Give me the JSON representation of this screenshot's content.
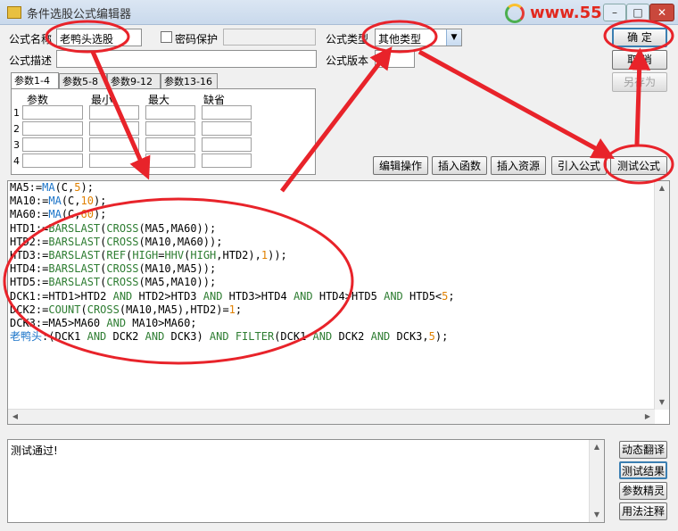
{
  "window": {
    "title": "条件选股公式编辑器",
    "watermark": "www.5518",
    "controls": [
      "–",
      "□",
      "✕"
    ]
  },
  "form": {
    "name_label": "公式名称",
    "name_value": "老鸭头选股",
    "password_label": "密码保护",
    "type_label": "公式类型",
    "type_value": "其他类型",
    "desc_label": "公式描述",
    "desc_value": "",
    "version_label": "公式版本",
    "version_value": "0"
  },
  "buttons": {
    "ok": "确  定",
    "cancel": "取  消",
    "save_as": "另存为",
    "edit_op": "编辑操作",
    "insert_func": "插入函数",
    "insert_res": "插入资源",
    "import": "引入公式",
    "test": "测试公式"
  },
  "params": {
    "tabs": [
      "参数1-4",
      "参数5-8",
      "参数9-12",
      "参数13-16"
    ],
    "headers": [
      "参数",
      "最小",
      "最大",
      "缺省"
    ],
    "rows": [
      "1",
      "2",
      "3",
      "4"
    ]
  },
  "code_lines": [
    [
      {
        "t": "MA5:=",
        "c": "#000000"
      },
      {
        "t": "MA",
        "c": "#1a73c8"
      },
      {
        "t": "(C,",
        "c": "#000000"
      },
      {
        "t": "5",
        "c": "#e08000"
      },
      {
        "t": ");",
        "c": "#000000"
      }
    ],
    [
      {
        "t": "MA10:=",
        "c": "#000000"
      },
      {
        "t": "MA",
        "c": "#1a73c8"
      },
      {
        "t": "(C,",
        "c": "#000000"
      },
      {
        "t": "10",
        "c": "#e08000"
      },
      {
        "t": ");",
        "c": "#000000"
      }
    ],
    [
      {
        "t": "MA60:=",
        "c": "#000000"
      },
      {
        "t": "MA",
        "c": "#1a73c8"
      },
      {
        "t": "(C,",
        "c": "#000000"
      },
      {
        "t": "60",
        "c": "#e08000"
      },
      {
        "t": ");",
        "c": "#000000"
      }
    ],
    [
      {
        "t": "HTD1:=",
        "c": "#000000"
      },
      {
        "t": "BARSLAST",
        "c": "#2e7d32"
      },
      {
        "t": "(",
        "c": "#000000"
      },
      {
        "t": "CROSS",
        "c": "#2e7d32"
      },
      {
        "t": "(MA5,MA60));",
        "c": "#000000"
      }
    ],
    [
      {
        "t": "HTD2:=",
        "c": "#000000"
      },
      {
        "t": "BARSLAST",
        "c": "#2e7d32"
      },
      {
        "t": "(",
        "c": "#000000"
      },
      {
        "t": "CROSS",
        "c": "#2e7d32"
      },
      {
        "t": "(MA10,MA60));",
        "c": "#000000"
      }
    ],
    [
      {
        "t": "HTD3:=",
        "c": "#000000"
      },
      {
        "t": "BARSLAST",
        "c": "#2e7d32"
      },
      {
        "t": "(",
        "c": "#000000"
      },
      {
        "t": "REF",
        "c": "#2e7d32"
      },
      {
        "t": "(",
        "c": "#000000"
      },
      {
        "t": "HIGH",
        "c": "#2e7d32"
      },
      {
        "t": "=",
        "c": "#000000"
      },
      {
        "t": "HHV",
        "c": "#2e7d32"
      },
      {
        "t": "(",
        "c": "#000000"
      },
      {
        "t": "HIGH",
        "c": "#2e7d32"
      },
      {
        "t": ",HTD2),",
        "c": "#000000"
      },
      {
        "t": "1",
        "c": "#e08000"
      },
      {
        "t": "));",
        "c": "#000000"
      }
    ],
    [
      {
        "t": "HTD4:=",
        "c": "#000000"
      },
      {
        "t": "BARSLAST",
        "c": "#2e7d32"
      },
      {
        "t": "(",
        "c": "#000000"
      },
      {
        "t": "CROSS",
        "c": "#2e7d32"
      },
      {
        "t": "(MA10,MA5));",
        "c": "#000000"
      }
    ],
    [
      {
        "t": "HTD5:=",
        "c": "#000000"
      },
      {
        "t": "BARSLAST",
        "c": "#2e7d32"
      },
      {
        "t": "(",
        "c": "#000000"
      },
      {
        "t": "CROSS",
        "c": "#2e7d32"
      },
      {
        "t": "(MA5,MA10));",
        "c": "#000000"
      }
    ],
    [
      {
        "t": "DCK1:=HTD1>HTD2 ",
        "c": "#000000"
      },
      {
        "t": "AND",
        "c": "#2e7d32"
      },
      {
        "t": " HTD2>HTD3 ",
        "c": "#000000"
      },
      {
        "t": "AND",
        "c": "#2e7d32"
      },
      {
        "t": " HTD3>HTD4 ",
        "c": "#000000"
      },
      {
        "t": "AND",
        "c": "#2e7d32"
      },
      {
        "t": " HTD4>HTD5 ",
        "c": "#000000"
      },
      {
        "t": "AND",
        "c": "#2e7d32"
      },
      {
        "t": " HTD5<",
        "c": "#000000"
      },
      {
        "t": "5",
        "c": "#e08000"
      },
      {
        "t": ";",
        "c": "#000000"
      }
    ],
    [
      {
        "t": "DCK2:=",
        "c": "#000000"
      },
      {
        "t": "COUNT",
        "c": "#2e7d32"
      },
      {
        "t": "(",
        "c": "#000000"
      },
      {
        "t": "CROSS",
        "c": "#2e7d32"
      },
      {
        "t": "(MA10,MA5),HTD2)=",
        "c": "#000000"
      },
      {
        "t": "1",
        "c": "#e08000"
      },
      {
        "t": ";",
        "c": "#000000"
      }
    ],
    [
      {
        "t": "DCK3:=MA5>MA60 ",
        "c": "#000000"
      },
      {
        "t": "AND",
        "c": "#2e7d32"
      },
      {
        "t": " MA10>MA60;",
        "c": "#000000"
      }
    ],
    [
      {
        "t": "老鸭头",
        "c": "#1a73c8"
      },
      {
        "t": ":(DCK1 ",
        "c": "#000000"
      },
      {
        "t": "AND",
        "c": "#2e7d32"
      },
      {
        "t": " DCK2 ",
        "c": "#000000"
      },
      {
        "t": "AND",
        "c": "#2e7d32"
      },
      {
        "t": " DCK3) ",
        "c": "#000000"
      },
      {
        "t": "AND",
        "c": "#2e7d32"
      },
      {
        "t": " ",
        "c": "#000000"
      },
      {
        "t": "FILTER",
        "c": "#2e7d32"
      },
      {
        "t": "(DCK1 ",
        "c": "#000000"
      },
      {
        "t": "AND",
        "c": "#2e7d32"
      },
      {
        "t": " DCK2 ",
        "c": "#000000"
      },
      {
        "t": "AND",
        "c": "#2e7d32"
      },
      {
        "t": " DCK3,",
        "c": "#000000"
      },
      {
        "t": "5",
        "c": "#e08000"
      },
      {
        "t": ");",
        "c": "#000000"
      }
    ]
  ],
  "output": {
    "text": "测试通过!"
  },
  "side_buttons": [
    "动态翻译",
    "测试结果",
    "参数精灵",
    "用法注释"
  ],
  "annotation_color": "#e8232a"
}
